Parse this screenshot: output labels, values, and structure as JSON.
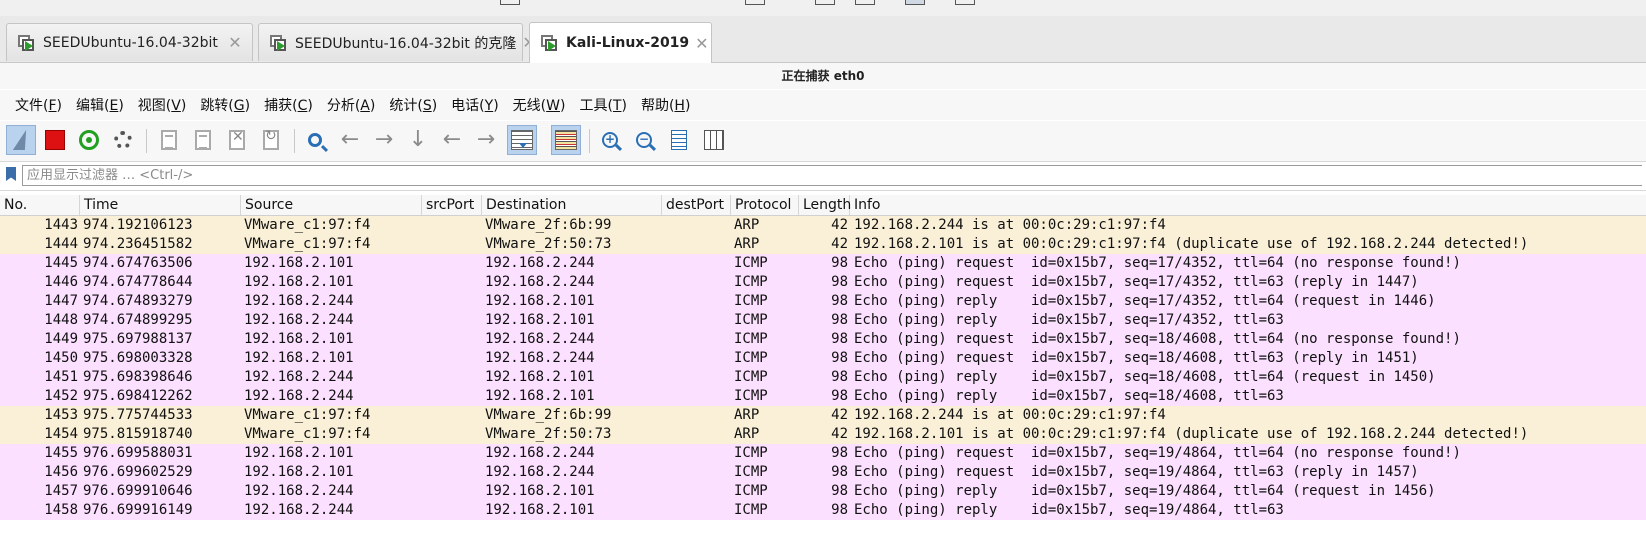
{
  "vm_tabs": [
    {
      "label": "SEEDUbuntu-16.04-32bit",
      "active": false
    },
    {
      "label": "SEEDUbuntu-16.04-32bit 的克隆",
      "active": false
    },
    {
      "label": "Kali-Linux-2019",
      "active": true
    }
  ],
  "window_title": "正在捕获 eth0",
  "menu": [
    {
      "label": "文件(",
      "acc": "F",
      "end": ")"
    },
    {
      "label": "编辑(",
      "acc": "E",
      "end": ")"
    },
    {
      "label": "视图(",
      "acc": "V",
      "end": ")"
    },
    {
      "label": "跳转(",
      "acc": "G",
      "end": ")"
    },
    {
      "label": "捕获(",
      "acc": "C",
      "end": ")"
    },
    {
      "label": "分析(",
      "acc": "A",
      "end": ")"
    },
    {
      "label": "统计(",
      "acc": "S",
      "end": ")"
    },
    {
      "label": "电话(",
      "acc": "Y",
      "end": ")"
    },
    {
      "label": "无线(",
      "acc": "W",
      "end": ")"
    },
    {
      "label": "工具(",
      "acc": "T",
      "end": ")"
    },
    {
      "label": "帮助(",
      "acc": "H",
      "end": ")"
    }
  ],
  "toolbar_icons": [
    "shark-fin-icon",
    "stop-capture-icon",
    "restart-capture-icon",
    "capture-options-icon",
    "open-file-icon",
    "save-file-icon",
    "close-file-icon",
    "reload-file-icon",
    "find-packet-icon",
    "go-back-icon",
    "go-forward-icon",
    "go-to-packet-icon",
    "go-first-icon",
    "go-last-icon",
    "autoscroll-icon",
    "colorize-icon",
    "zoom-in-icon",
    "zoom-out-icon",
    "normal-size-icon",
    "resize-columns-icon"
  ],
  "filter": {
    "placeholder": "应用显示过滤器 … <Ctrl-/>",
    "value": ""
  },
  "columns": [
    "No.",
    "Time",
    "Source",
    "srcPort",
    "Destination",
    "destPort",
    "Protocol",
    "Length",
    "Info"
  ],
  "colors": {
    "arp_row": "#faf0d7",
    "icmp_row": "#fce0ff",
    "pressed_button": "#b9d3ee"
  },
  "packets": [
    {
      "no": "1443",
      "time": "974.192106123",
      "src": "VMware_c1:97:f4",
      "srcPort": "",
      "dst": "VMware_2f:6b:99",
      "destPort": "",
      "proto": "ARP",
      "len": "42",
      "info": "192.168.2.244 is at 00:0c:29:c1:97:f4"
    },
    {
      "no": "1444",
      "time": "974.236451582",
      "src": "VMware_c1:97:f4",
      "srcPort": "",
      "dst": "VMware_2f:50:73",
      "destPort": "",
      "proto": "ARP",
      "len": "42",
      "info": "192.168.2.101 is at 00:0c:29:c1:97:f4 (duplicate use of 192.168.2.244 detected!)"
    },
    {
      "no": "1445",
      "time": "974.674763506",
      "src": "192.168.2.101",
      "srcPort": "",
      "dst": "192.168.2.244",
      "destPort": "",
      "proto": "ICMP",
      "len": "98",
      "info": "Echo (ping) request  id=0x15b7, seq=17/4352, ttl=64 (no response found!)"
    },
    {
      "no": "1446",
      "time": "974.674778644",
      "src": "192.168.2.101",
      "srcPort": "",
      "dst": "192.168.2.244",
      "destPort": "",
      "proto": "ICMP",
      "len": "98",
      "info": "Echo (ping) request  id=0x15b7, seq=17/4352, ttl=63 (reply in 1447)"
    },
    {
      "no": "1447",
      "time": "974.674893279",
      "src": "192.168.2.244",
      "srcPort": "",
      "dst": "192.168.2.101",
      "destPort": "",
      "proto": "ICMP",
      "len": "98",
      "info": "Echo (ping) reply    id=0x15b7, seq=17/4352, ttl=64 (request in 1446)"
    },
    {
      "no": "1448",
      "time": "974.674899295",
      "src": "192.168.2.244",
      "srcPort": "",
      "dst": "192.168.2.101",
      "destPort": "",
      "proto": "ICMP",
      "len": "98",
      "info": "Echo (ping) reply    id=0x15b7, seq=17/4352, ttl=63"
    },
    {
      "no": "1449",
      "time": "975.697988137",
      "src": "192.168.2.101",
      "srcPort": "",
      "dst": "192.168.2.244",
      "destPort": "",
      "proto": "ICMP",
      "len": "98",
      "info": "Echo (ping) request  id=0x15b7, seq=18/4608, ttl=64 (no response found!)"
    },
    {
      "no": "1450",
      "time": "975.698003328",
      "src": "192.168.2.101",
      "srcPort": "",
      "dst": "192.168.2.244",
      "destPort": "",
      "proto": "ICMP",
      "len": "98",
      "info": "Echo (ping) request  id=0x15b7, seq=18/4608, ttl=63 (reply in 1451)"
    },
    {
      "no": "1451",
      "time": "975.698398646",
      "src": "192.168.2.244",
      "srcPort": "",
      "dst": "192.168.2.101",
      "destPort": "",
      "proto": "ICMP",
      "len": "98",
      "info": "Echo (ping) reply    id=0x15b7, seq=18/4608, ttl=64 (request in 1450)"
    },
    {
      "no": "1452",
      "time": "975.698412262",
      "src": "192.168.2.244",
      "srcPort": "",
      "dst": "192.168.2.101",
      "destPort": "",
      "proto": "ICMP",
      "len": "98",
      "info": "Echo (ping) reply    id=0x15b7, seq=18/4608, ttl=63"
    },
    {
      "no": "1453",
      "time": "975.775744533",
      "src": "VMware_c1:97:f4",
      "srcPort": "",
      "dst": "VMware_2f:6b:99",
      "destPort": "",
      "proto": "ARP",
      "len": "42",
      "info": "192.168.2.244 is at 00:0c:29:c1:97:f4"
    },
    {
      "no": "1454",
      "time": "975.815918740",
      "src": "VMware_c1:97:f4",
      "srcPort": "",
      "dst": "VMware_2f:50:73",
      "destPort": "",
      "proto": "ARP",
      "len": "42",
      "info": "192.168.2.101 is at 00:0c:29:c1:97:f4 (duplicate use of 192.168.2.244 detected!)"
    },
    {
      "no": "1455",
      "time": "976.699588031",
      "src": "192.168.2.101",
      "srcPort": "",
      "dst": "192.168.2.244",
      "destPort": "",
      "proto": "ICMP",
      "len": "98",
      "info": "Echo (ping) request  id=0x15b7, seq=19/4864, ttl=64 (no response found!)"
    },
    {
      "no": "1456",
      "time": "976.699602529",
      "src": "192.168.2.101",
      "srcPort": "",
      "dst": "192.168.2.244",
      "destPort": "",
      "proto": "ICMP",
      "len": "98",
      "info": "Echo (ping) request  id=0x15b7, seq=19/4864, ttl=63 (reply in 1457)"
    },
    {
      "no": "1457",
      "time": "976.699910646",
      "src": "192.168.2.244",
      "srcPort": "",
      "dst": "192.168.2.101",
      "destPort": "",
      "proto": "ICMP",
      "len": "98",
      "info": "Echo (ping) reply    id=0x15b7, seq=19/4864, ttl=64 (request in 1456)"
    },
    {
      "no": "1458",
      "time": "976.699916149",
      "src": "192.168.2.244",
      "srcPort": "",
      "dst": "192.168.2.101",
      "destPort": "",
      "proto": "ICMP",
      "len": "98",
      "info": "Echo (ping) reply    id=0x15b7, seq=19/4864, ttl=63"
    }
  ]
}
